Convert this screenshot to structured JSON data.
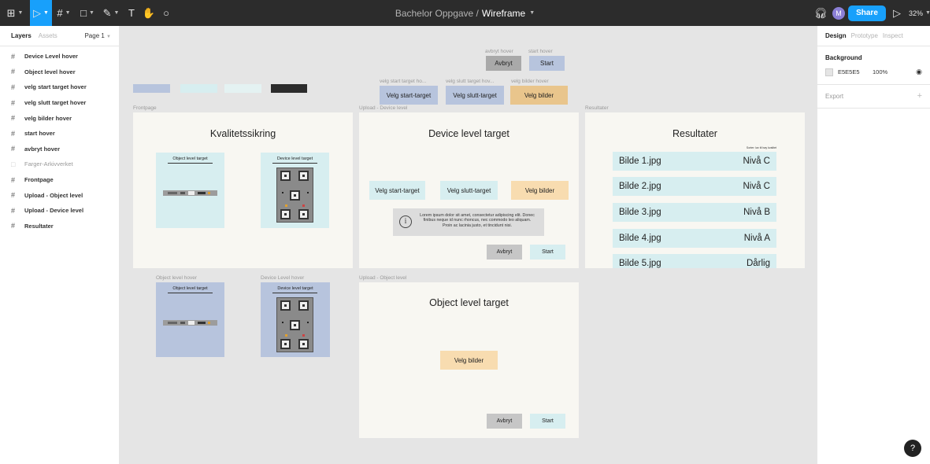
{
  "toolbar": {
    "title_path": "Bachelor Oppgave /",
    "title_doc": "Wireframe",
    "share_label": "Share",
    "avatar_initial": "M",
    "zoom": "32%"
  },
  "left_panel": {
    "tab_layers": "Layers",
    "tab_assets": "Assets",
    "page": "Page 1",
    "layers": [
      {
        "label": "Device Level hover"
      },
      {
        "label": "Object level hover"
      },
      {
        "label": "velg start target hover"
      },
      {
        "label": "velg slutt target hover"
      },
      {
        "label": "velg bilder hover"
      },
      {
        "label": "start hover"
      },
      {
        "label": "avbryt hover"
      },
      {
        "label": "Farger-Arkivverket"
      },
      {
        "label": "Frontpage"
      },
      {
        "label": "Upload - Object level"
      },
      {
        "label": "Upload - Device level"
      },
      {
        "label": "Resultater"
      }
    ]
  },
  "right_panel": {
    "tab_design": "Design",
    "tab_prototype": "Prototype",
    "tab_inspect": "Inspect",
    "background_label": "Background",
    "bg_hex": "E5E5E5",
    "bg_opacity": "100%",
    "export_label": "Export"
  },
  "colors": {
    "blue": "#b7c4dd",
    "cyan": "#d7eef0",
    "light_cyan": "#e4f2f2",
    "dark": "#2c2c2c",
    "orange": "#f8dcb0",
    "frame_bg": "#f8f7f2"
  },
  "canvas": {
    "components": {
      "avbryt_hover_label": "avbryt hover",
      "start_hover_label": "start hover",
      "avbryt": "Avbryt",
      "start": "Start",
      "velg_start_label": "velg start target ho...",
      "velg_slutt_label": "velg slutt target hov...",
      "velg_bilder_label": "velg bilder hover",
      "velg_start": "Velg start-target",
      "velg_slutt": "Velg slutt-target",
      "velg_bilder": "Velg bilder"
    },
    "frontpage": {
      "label": "Frontpage",
      "title": "Kvalitetssikring",
      "card_object": "Object level target",
      "card_device": "Device level target"
    },
    "hover_cards": {
      "object_label": "Object level hover",
      "device_label": "Device Level hover",
      "card_object": "Object level target",
      "card_device": "Device level target"
    },
    "upload_device": {
      "label": "Upload - Device level",
      "title": "Device level target",
      "velg_start": "Velg start-target",
      "velg_slutt": "Velg slutt-target",
      "velg_bilder": "Velg bilder",
      "info_text": "Lorem ipsum dolor sit amet, consectetur adipiscing elit. Donec finibus neque id nunc rhoncus, nec commodo leo aliquam. Proin ac lacinia justo, et tincidunt nisi.",
      "avbryt": "Avbryt",
      "start": "Start"
    },
    "upload_object": {
      "label": "Upload - Object level",
      "title": "Object level target",
      "velg_bilder": "Velg bilder",
      "avbryt": "Avbryt",
      "start": "Start"
    },
    "resultater": {
      "label": "Resultater",
      "title": "Resultater",
      "sort_text": "Sorter: lav til høy kvalitet",
      "rows": [
        {
          "file": "Bilde 1.jpg",
          "level": "Nivå C"
        },
        {
          "file": "Bilde 2.jpg",
          "level": "Nivå C"
        },
        {
          "file": "Bilde 3.jpg",
          "level": "Nivå B"
        },
        {
          "file": "Bilde 4.jpg",
          "level": "Nivå A"
        },
        {
          "file": "Bilde 5.jpg",
          "level": "Dårlig"
        }
      ]
    }
  }
}
